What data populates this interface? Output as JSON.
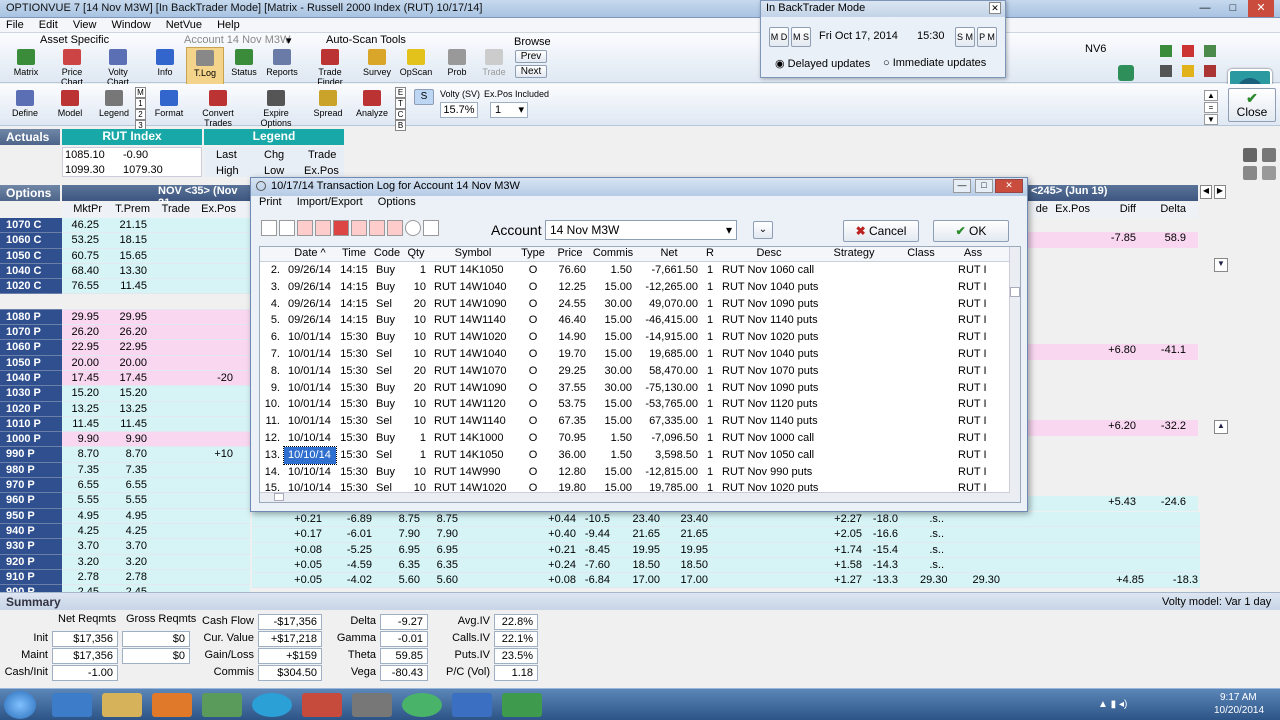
{
  "window": {
    "title": "OPTIONVUE 7   [14 Nov M3W]   [In BackTrader Mode]   [Matrix - Russell 2000 Index (RUT)  10/17/14]",
    "min": "—",
    "max": "□",
    "close": "✕"
  },
  "menu": [
    "File",
    "Edit",
    "View",
    "Window",
    "NetVue",
    "Help"
  ],
  "ribbon": {
    "asset_specific": "Asset Specific",
    "account_combo": "Account  14 Nov M3W",
    "auto_scan": "Auto-Scan Tools",
    "browse": "Browse",
    "prev": "Prev",
    "next": "Next",
    "buttons": [
      "Matrix",
      "Price Chart",
      "Volty Chart",
      "Info",
      "T.Log",
      "Status",
      "Reports",
      "Trade Finder",
      "Survey",
      "OpScan",
      "Prob",
      "Trade"
    ],
    "row2": [
      "Define",
      "Model",
      "Legend",
      "Format",
      "Convert Trades",
      "Expire Options",
      "Spread",
      "Analyze"
    ],
    "m_labels": [
      "M",
      "1",
      "2",
      "3"
    ],
    "e_labels": [
      "E",
      "T",
      "C",
      "B"
    ],
    "s_label": "S",
    "volty_label": "Volty (SV)",
    "volty_value": "15.7%",
    "expos_label": "Ex.Pos Included",
    "expos_value": "1",
    "nv6": "NV6",
    "close": "Close"
  },
  "backtrader": {
    "title": "In BackTrader Mode",
    "md": "M D",
    "ms": "M S",
    "date": "Fri Oct 17, 2014",
    "time": "15:30",
    "sm": "S M",
    "pm": "P M",
    "delayed": "Delayed updates",
    "immediate": "Immediate updates"
  },
  "actuals": {
    "label": "Actuals",
    "index": "RUT Index",
    "legend": "Legend",
    "row1": [
      "1085.10",
      "-0.90"
    ],
    "row2": [
      "1099.30",
      "1079.30"
    ],
    "legend_cells": [
      "Last",
      "Chg",
      "Trade",
      "High",
      "Low",
      "Ex.Pos"
    ]
  },
  "options_hdr": {
    "label": "Options",
    "left_title": "NOV <35> (Nov 21",
    "right_title": "<245> (Jun 19)",
    "left_cols": [
      "MktPr",
      "T.Prem",
      "Trade",
      "Ex.Pos"
    ],
    "right_cols": [
      "de",
      "Ex.Pos",
      "Diff",
      "Delta"
    ]
  },
  "options": [
    {
      "lbl": "1070 C",
      "mkt": "46.25",
      "tprem": "21.15",
      "trade": "",
      "expos": "",
      "type": "call"
    },
    {
      "lbl": "1060 C",
      "mkt": "53.25",
      "tprem": "18.15",
      "trade": "",
      "expos": "",
      "type": "call"
    },
    {
      "lbl": "1050 C",
      "mkt": "60.75",
      "tprem": "15.65",
      "trade": "",
      "expos": "",
      "type": "call"
    },
    {
      "lbl": "1040 C",
      "mkt": "68.40",
      "tprem": "13.30",
      "trade": "",
      "expos": "",
      "type": "call"
    },
    {
      "lbl": "1020 C",
      "mkt": "76.55",
      "tprem": "11.45",
      "trade": "",
      "expos": "",
      "type": "call"
    },
    {
      "lbl": "",
      "mkt": "",
      "tprem": "",
      "trade": "",
      "expos": "",
      "type": "blank"
    },
    {
      "lbl": "1080 P",
      "mkt": "29.95",
      "tprem": "29.95",
      "trade": "",
      "expos": "",
      "type": "put"
    },
    {
      "lbl": "1070 P",
      "mkt": "26.20",
      "tprem": "26.20",
      "trade": "",
      "expos": "",
      "type": "put"
    },
    {
      "lbl": "1060 P",
      "mkt": "22.95",
      "tprem": "22.95",
      "trade": "",
      "expos": "",
      "type": "put"
    },
    {
      "lbl": "1050 P",
      "mkt": "20.00",
      "tprem": "20.00",
      "trade": "",
      "expos": "",
      "type": "put"
    },
    {
      "lbl": "1040 P",
      "mkt": "17.45",
      "tprem": "17.45",
      "trade": "",
      "expos": "-20",
      "type": "put"
    },
    {
      "lbl": "1030 P",
      "mkt": "15.20",
      "tprem": "15.20",
      "trade": "",
      "expos": "",
      "type": "call"
    },
    {
      "lbl": "1020 P",
      "mkt": "13.25",
      "tprem": "13.25",
      "trade": "",
      "expos": "",
      "type": "call"
    },
    {
      "lbl": "1010 P",
      "mkt": "11.45",
      "tprem": "11.45",
      "trade": "",
      "expos": "",
      "type": "call"
    },
    {
      "lbl": "1000 P",
      "mkt": "9.90",
      "tprem": "9.90",
      "trade": "",
      "expos": "",
      "type": "put"
    },
    {
      "lbl": "990 P",
      "mkt": "8.70",
      "tprem": "8.70",
      "trade": "",
      "expos": "+10",
      "type": "call"
    },
    {
      "lbl": "980 P",
      "mkt": "7.35",
      "tprem": "7.35",
      "trade": "",
      "expos": "",
      "type": "call"
    },
    {
      "lbl": "970 P",
      "mkt": "6.55",
      "tprem": "6.55",
      "trade": "",
      "expos": "",
      "type": "call"
    },
    {
      "lbl": "960 P",
      "mkt": "5.55",
      "tprem": "5.55",
      "trade": "",
      "expos": "",
      "type": "call"
    },
    {
      "lbl": "950 P",
      "mkt": "4.95",
      "tprem": "4.95",
      "trade": "",
      "expos": "",
      "type": "call"
    },
    {
      "lbl": "940 P",
      "mkt": "4.25",
      "tprem": "4.25",
      "trade": "",
      "expos": "",
      "type": "call"
    },
    {
      "lbl": "930 P",
      "mkt": "3.70",
      "tprem": "3.70",
      "trade": "",
      "expos": "",
      "type": "call"
    },
    {
      "lbl": "920 P",
      "mkt": "3.20",
      "tprem": "3.20",
      "trade": "",
      "expos": "",
      "type": "call"
    },
    {
      "lbl": "910 P",
      "mkt": "2.78",
      "tprem": "2.78",
      "trade": "",
      "expos": "",
      "type": "call"
    },
    {
      "lbl": "900 P",
      "mkt": "2.45",
      "tprem": "2.45",
      "trade": "",
      "expos": "",
      "type": "call"
    }
  ],
  "right_values": [
    {
      "diff": "-7.85",
      "delta": "58.9"
    },
    {
      "diff": "+6.80",
      "delta": "-41.1"
    },
    {
      "diff": "+6.20",
      "delta": "-32.2"
    },
    {
      "diff": "+5.43",
      "delta": "-24.6"
    }
  ],
  "lower_rows": [
    [
      "940 P",
      "+0.21",
      "-6.89",
      "8.75",
      "8.75",
      "+0.44",
      "-10.5",
      "23.40",
      "23.40",
      "+2.27",
      "-18.0",
      ".s.."
    ],
    [
      "930 P",
      "+0.17",
      "-6.01",
      "7.90",
      "7.90",
      "+0.40",
      "-9.44",
      "21.65",
      "21.65",
      "+2.05",
      "-16.6",
      ".s.."
    ],
    [
      "920 P",
      "+0.08",
      "-5.25",
      "6.95",
      "6.95",
      "+0.21",
      "-8.45",
      "19.95",
      "19.95",
      "+1.74",
      "-15.4",
      ".s.."
    ],
    [
      "910 P",
      "+0.05",
      "-4.59",
      "6.35",
      "6.35",
      "+0.24",
      "-7.60",
      "18.50",
      "18.50",
      "+1.58",
      "-14.3",
      ".s.."
    ],
    [
      "900 P",
      "+0.05",
      "-4.02",
      "5.60",
      "5.60",
      "+0.08",
      "-6.84",
      "17.00",
      "17.00",
      "+1.27",
      "-13.3",
      "29.30",
      "29.30",
      "+4.85",
      "-18.3"
    ]
  ],
  "dialog": {
    "title": "10/17/14  Transaction Log for Account  14 Nov M3W",
    "menu": [
      "Print",
      "Import/Export",
      "Options"
    ],
    "account_label": "Account",
    "account_value": "14 Nov M3W",
    "cancel": "Cancel",
    "ok": "OK",
    "columns": [
      "",
      "Date ^",
      "Time",
      "Code",
      "Qty",
      "Symbol",
      "Type",
      "Price",
      "Commis",
      "Net",
      "R",
      "Desc",
      "Strategy",
      "Class",
      "Ass"
    ],
    "rows": [
      [
        "2.",
        "09/26/14",
        "14:15",
        "Buy",
        "1",
        "RUT 14K1050",
        "O",
        "76.60",
        "1.50",
        "-7,661.50",
        "1",
        "RUT Nov 1060 call",
        "",
        "",
        "RUT I"
      ],
      [
        "3.",
        "09/26/14",
        "14:15",
        "Buy",
        "10",
        "RUT 14W1040",
        "O",
        "12.25",
        "15.00",
        "-12,265.00",
        "1",
        "RUT Nov 1040 puts",
        "",
        "",
        "RUT I"
      ],
      [
        "4.",
        "09/26/14",
        "14:15",
        "Sel",
        "20",
        "RUT 14W1090",
        "O",
        "24.55",
        "30.00",
        "49,070.00",
        "1",
        "RUT Nov 1090 puts",
        "",
        "",
        "RUT I"
      ],
      [
        "5.",
        "09/26/14",
        "14:15",
        "Buy",
        "10",
        "RUT 14W1140",
        "O",
        "46.40",
        "15.00",
        "-46,415.00",
        "1",
        "RUT Nov 1140 puts",
        "",
        "",
        "RUT I"
      ],
      [
        "6.",
        "10/01/14",
        "15:30",
        "Buy",
        "10",
        "RUT 14W1020",
        "O",
        "14.90",
        "15.00",
        "-14,915.00",
        "1",
        "RUT Nov 1020 puts",
        "",
        "",
        "RUT I"
      ],
      [
        "7.",
        "10/01/14",
        "15:30",
        "Sel",
        "10",
        "RUT 14W1040",
        "O",
        "19.70",
        "15.00",
        "19,685.00",
        "1",
        "RUT Nov 1040 puts",
        "",
        "",
        "RUT I"
      ],
      [
        "8.",
        "10/01/14",
        "15:30",
        "Sel",
        "20",
        "RUT 14W1070",
        "O",
        "29.25",
        "30.00",
        "58,470.00",
        "1",
        "RUT Nov 1070 puts",
        "",
        "",
        "RUT I"
      ],
      [
        "9.",
        "10/01/14",
        "15:30",
        "Buy",
        "20",
        "RUT 14W1090",
        "O",
        "37.55",
        "30.00",
        "-75,130.00",
        "1",
        "RUT Nov 1090 puts",
        "",
        "",
        "RUT I"
      ],
      [
        "10.",
        "10/01/14",
        "15:30",
        "Buy",
        "10",
        "RUT 14W1120",
        "O",
        "53.75",
        "15.00",
        "-53,765.00",
        "1",
        "RUT Nov 1120 puts",
        "",
        "",
        "RUT I"
      ],
      [
        "11.",
        "10/01/14",
        "15:30",
        "Sel",
        "10",
        "RUT 14W1140",
        "O",
        "67.35",
        "15.00",
        "67,335.00",
        "1",
        "RUT Nov 1140 puts",
        "",
        "",
        "RUT I"
      ],
      [
        "12.",
        "10/10/14",
        "15:30",
        "Buy",
        "1",
        "RUT 14K1000",
        "O",
        "70.95",
        "1.50",
        "-7,096.50",
        "1",
        "RUT Nov 1000 call",
        "",
        "",
        "RUT I"
      ],
      [
        "13.",
        "10/10/14",
        "15:30",
        "Sel",
        "1",
        "RUT 14K1050",
        "O",
        "36.00",
        "1.50",
        "3,598.50",
        "1",
        "RUT Nov 1050 call",
        "",
        "",
        "RUT I"
      ],
      [
        "14.",
        "10/10/14",
        "15:30",
        "Buy",
        "10",
        "RUT 14W990",
        "O",
        "12.80",
        "15.00",
        "-12,815.00",
        "1",
        "RUT Nov 990 puts",
        "",
        "",
        "RUT I"
      ],
      [
        "15.",
        "10/10/14",
        "15:30",
        "Sel",
        "10",
        "RUT 14W1020",
        "O",
        "19.80",
        "15.00",
        "19,785.00",
        "1",
        "RUT Nov 1020 puts",
        "",
        "",
        "RUT I"
      ]
    ]
  },
  "summary": {
    "label": "Summary",
    "volty_model": "Volty model: Var 1 day",
    "net_reqmts": "Net Reqmts",
    "gross_reqmts": "Gross Reqmts",
    "init_label": "Init",
    "init_net": "$17,356",
    "init_gross": "$0",
    "maint_label": "Maint",
    "maint_net": "$17,356",
    "maint_gross": "$0",
    "cashinit_label": "Cash/Init",
    "cashinit_val": "-1.00",
    "cash_flow_label": "Cash Flow",
    "cash_flow": "-$17,356",
    "cur_value_label": "Cur. Value",
    "cur_value": "+$17,218",
    "gain_loss_label": "Gain/Loss",
    "gain_loss": "+$159",
    "commis_label": "Commis",
    "commis": "$304.50",
    "delta_label": "Delta",
    "delta": "-9.27",
    "gamma_label": "Gamma",
    "gamma": "-0.01",
    "theta_label": "Theta",
    "theta": "59.85",
    "vega_label": "Vega",
    "vega": "-80.43",
    "avgiv_label": "Avg.IV",
    "avgiv": "22.8%",
    "callsiv_label": "Calls.IV",
    "callsiv": "22.1%",
    "putsiv_label": "Puts.IV",
    "putsiv": "23.5%",
    "pcvol_label": "P/C (Vol)",
    "pcvol": "1.18"
  },
  "taskbar": {
    "time": "9:17 AM",
    "date": "10/20/2014"
  }
}
